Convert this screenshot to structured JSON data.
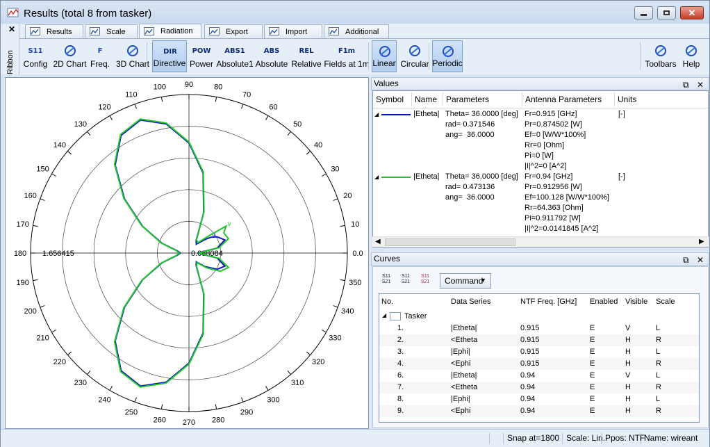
{
  "window": {
    "title": "Results (total 8 from tasker)"
  },
  "ribbon": {
    "label": "Ribbon",
    "close": "✕",
    "tabs": [
      "Results",
      "Scale",
      "Radiation",
      "Export",
      "Import",
      "Additional"
    ],
    "active_tab": "Radiation",
    "buttons": [
      {
        "label": "Config",
        "icon": "S11",
        "icon_name": "config-icon"
      },
      {
        "label": "2D Chart",
        "icon": "",
        "icon_name": "2d-chart-icon"
      },
      {
        "label": "Freq.",
        "icon": "F",
        "icon_name": "frequency-icon"
      },
      {
        "label": "3D Chart",
        "icon": "",
        "icon_name": "3d-chart-icon"
      },
      {
        "label": "Directive",
        "icon": "DIR",
        "icon_name": "directive-icon"
      },
      {
        "label": "Power",
        "icon": "POW",
        "icon_name": "power-icon"
      },
      {
        "label": "Absolute1",
        "icon": "ABS1",
        "icon_name": "absolute1-icon"
      },
      {
        "label": "Absolute",
        "icon": "ABS",
        "icon_name": "absolute-icon"
      },
      {
        "label": "Relative",
        "icon": "REL",
        "icon_name": "relative-icon"
      },
      {
        "label": "Fields at 1m",
        "icon": "F1m",
        "icon_name": "fields-at-1m-icon"
      },
      {
        "label": "Linear",
        "icon": "",
        "icon_name": "linear-icon"
      },
      {
        "label": "Circular",
        "icon": "",
        "icon_name": "circular-icon"
      },
      {
        "label": "Periodic",
        "icon": "",
        "icon_name": "periodic-icon"
      },
      {
        "label": "Toolbars",
        "icon": "",
        "icon_name": "toolbars-icon"
      },
      {
        "label": "Help",
        "icon": "",
        "icon_name": "help-icon"
      }
    ]
  },
  "chart_data": {
    "type": "polar",
    "angle_ticks": [
      "0.0",
      "10",
      "20",
      "30",
      "40",
      "50",
      "60",
      "70",
      "80",
      "90",
      "100",
      "110",
      "120",
      "130",
      "140",
      "150",
      "160",
      "170",
      "180",
      "190",
      "200",
      "210",
      "220",
      "230",
      "240",
      "250",
      "260",
      "270",
      "280",
      "290",
      "300",
      "310",
      "320",
      "330",
      "340",
      "350"
    ],
    "radial_max_label": "1.656415",
    "radial_min_label": "0.088084",
    "series": [
      {
        "color": "#0a17c8",
        "theta_deg": [
          0,
          10,
          20,
          30,
          36,
          40,
          50,
          60,
          70,
          80,
          90,
          100,
          110,
          120,
          130,
          140,
          150,
          160,
          170,
          180,
          190,
          200,
          210,
          220,
          230,
          240,
          250,
          260,
          270,
          280,
          290,
          300,
          310,
          320,
          330,
          340,
          350
        ],
        "r": [
          0.09,
          0.3,
          0.4,
          0.34,
          0.28,
          0.22,
          0.12,
          0.15,
          0.45,
          0.85,
          1.15,
          1.37,
          1.48,
          1.42,
          1.2,
          0.88,
          0.56,
          0.3,
          0.12,
          0.09,
          0.12,
          0.3,
          0.56,
          0.88,
          1.2,
          1.42,
          1.48,
          1.37,
          1.15,
          0.85,
          0.45,
          0.15,
          0.12,
          0.22,
          0.34,
          0.4,
          0.3
        ]
      },
      {
        "color": "#22c42a",
        "theta_deg": [
          0,
          10,
          20,
          30,
          36,
          40,
          50,
          60,
          70,
          80,
          90,
          100,
          110,
          120,
          130,
          140,
          150,
          160,
          170,
          180,
          190,
          200,
          210,
          220,
          230,
          240,
          250,
          260,
          270,
          280,
          290,
          300,
          310,
          320,
          330,
          340,
          350
        ],
        "r": [
          0.1,
          0.32,
          0.44,
          0.42,
          0.48,
          0.3,
          0.14,
          0.16,
          0.46,
          0.86,
          1.16,
          1.38,
          1.49,
          1.43,
          1.21,
          0.89,
          0.57,
          0.31,
          0.13,
          0.1,
          0.13,
          0.31,
          0.57,
          0.89,
          1.21,
          1.43,
          1.49,
          1.38,
          1.16,
          0.86,
          0.46,
          0.16,
          0.13,
          0.24,
          0.38,
          0.44,
          0.32
        ]
      }
    ]
  },
  "values_panel": {
    "title": "Values",
    "columns": [
      "Symbol",
      "Name",
      "Parameters",
      "Antenna Parameters",
      "Units"
    ],
    "rows": [
      {
        "symbol_color": "#0a17c8",
        "name": "|Etheta|",
        "params": "Theta= 36.0000 [deg]\nrad= 0.371546\nang=  36.0000",
        "antenna": "Fr=0.915 [GHz]\nPr=0.874502 [W]\nEf=0 [W/W*100%]\nRr=0 [Ohm]\nPi=0 [W]\n|I|^2=0 [A^2]",
        "units": "[-]"
      },
      {
        "symbol_color": "#22c42a",
        "name": "|Etheta|",
        "params": "Theta= 36.0000 [deg]\nrad= 0.473136\nang=  36.0000",
        "antenna": "Fr=0.94 [GHz]\nPr=0.912956 [W]\nEf=100.128 [W/W*100%]\nRr=64.363 [Ohm]\nPi=0.911792 [W]\n|I|^2=0.0141845 [A^2]",
        "units": "[-]"
      }
    ]
  },
  "curves_panel": {
    "title": "Curves",
    "command_label": "Command",
    "columns": [
      "No.",
      "Data Series",
      "NTF Freq. [GHz]",
      "Enabled",
      "Visible",
      "Scale"
    ],
    "group": "Tasker",
    "rows": [
      {
        "no": "1.",
        "series": "|Etheta|",
        "freq": "0.915",
        "enabled": "E",
        "visible": "V",
        "scale": "L"
      },
      {
        "no": "2.",
        "series": "<Etheta",
        "freq": "0.915",
        "enabled": "E",
        "visible": "H",
        "scale": "R"
      },
      {
        "no": "3.",
        "series": "|Ephi|",
        "freq": "0.915",
        "enabled": "E",
        "visible": "H",
        "scale": "L"
      },
      {
        "no": "4.",
        "series": "<Ephi",
        "freq": "0.915",
        "enabled": "E",
        "visible": "H",
        "scale": "R"
      },
      {
        "no": "6.",
        "series": "|Etheta|",
        "freq": "0.94",
        "enabled": "E",
        "visible": "V",
        "scale": "L"
      },
      {
        "no": "7.",
        "series": "<Etheta",
        "freq": "0.94",
        "enabled": "E",
        "visible": "H",
        "scale": "R"
      },
      {
        "no": "8.",
        "series": "|Ephi|",
        "freq": "0.94",
        "enabled": "E",
        "visible": "H",
        "scale": "L"
      },
      {
        "no": "9.",
        "series": "<Ephi",
        "freq": "0.94",
        "enabled": "E",
        "visible": "H",
        "scale": "R"
      }
    ]
  },
  "status": {
    "snap": "Snap at=1800",
    "scale": "Scale: Lin.",
    "ppos": "Ppos: NTF",
    "name": "Name: wireant"
  }
}
